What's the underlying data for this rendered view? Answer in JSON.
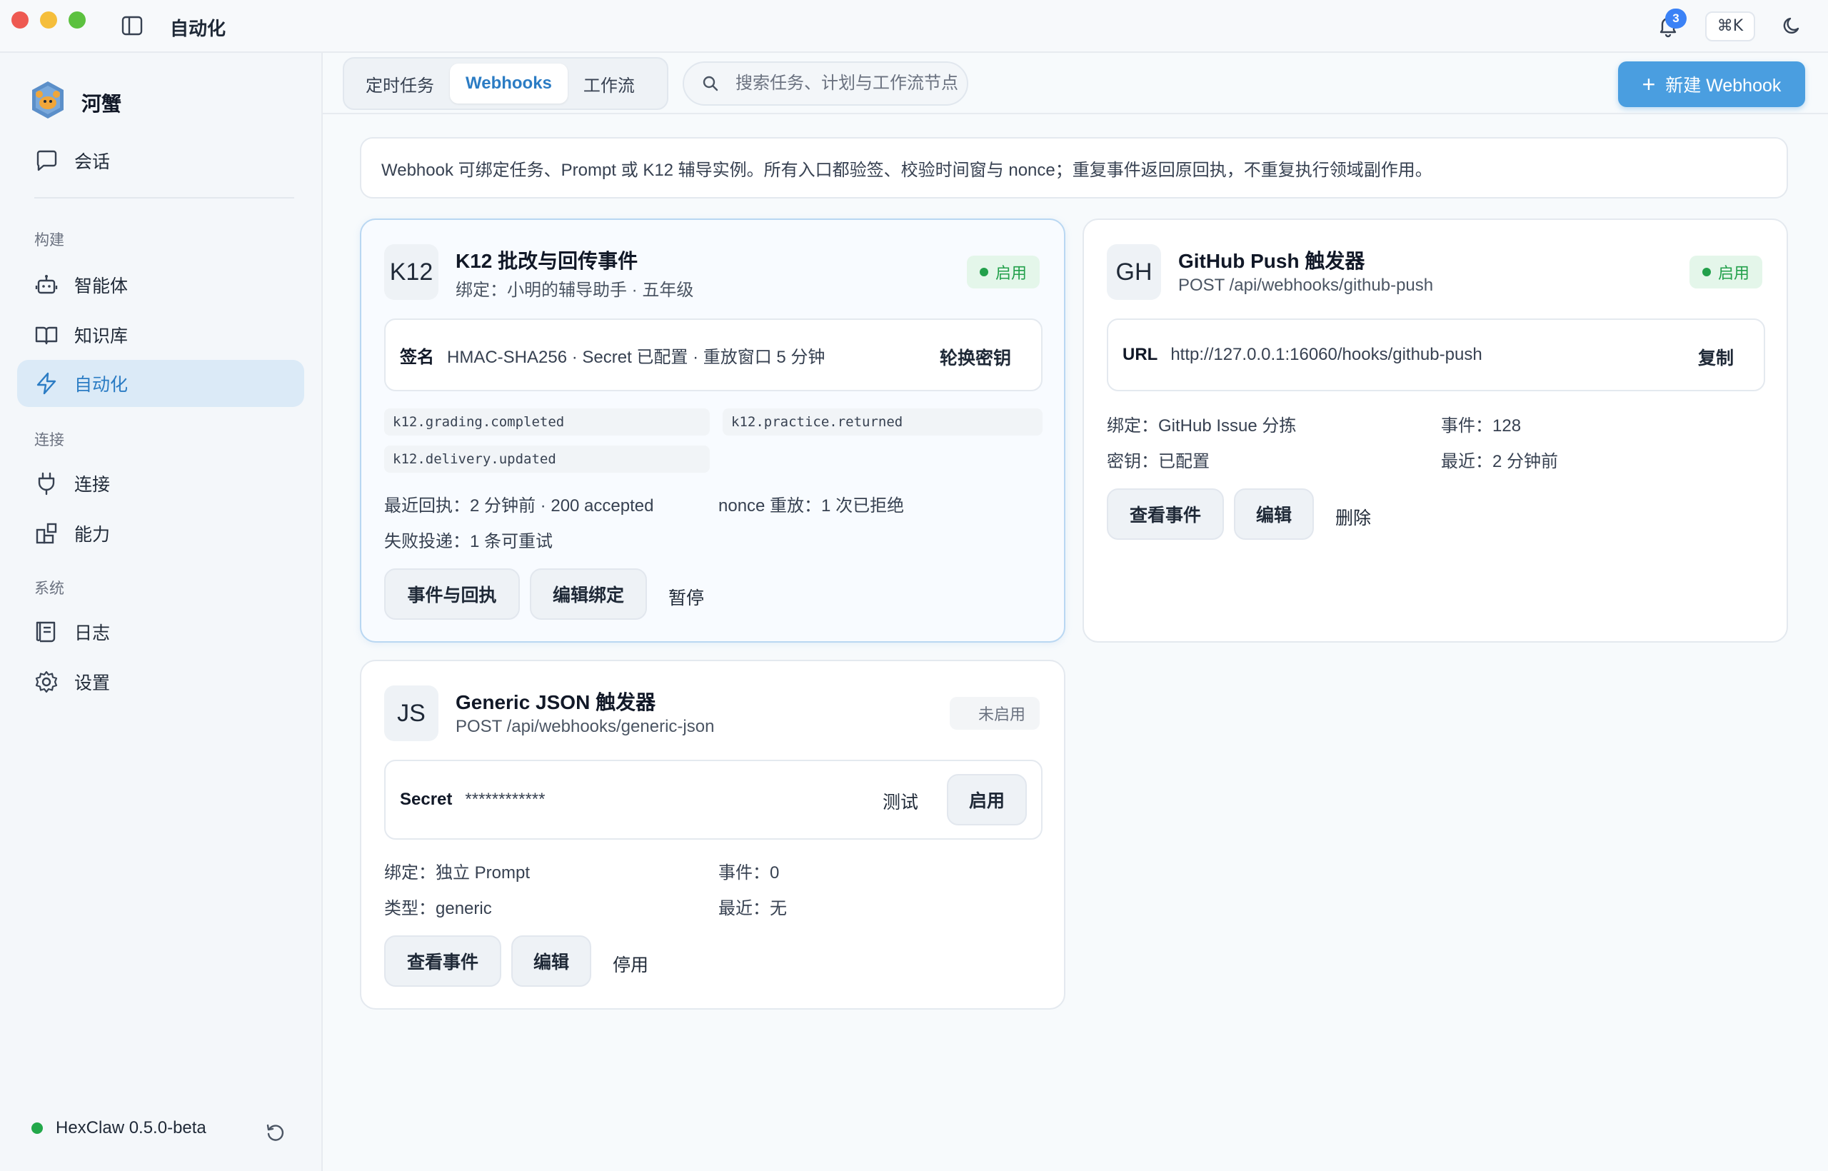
{
  "window": {
    "title": "自动化",
    "notifications": "3",
    "shortcut": "⌘K"
  },
  "sidebar": {
    "brand": "河蟹",
    "top_item": "会话",
    "sections": {
      "build": "构建",
      "connect": "连接",
      "system": "系统"
    },
    "items": {
      "agents": "智能体",
      "knowledge": "知识库",
      "automation": "自动化",
      "connections": "连接",
      "capabilities": "能力",
      "logs": "日志",
      "settings": "设置"
    },
    "version": "HexClaw 0.5.0-beta"
  },
  "toolbar": {
    "tabs": [
      "定时任务",
      "Webhooks",
      "工作流"
    ],
    "active_tab": "Webhooks",
    "search_placeholder": "搜索任务、计划与工作流节点",
    "new_button": "新建 Webhook"
  },
  "info_text": "Webhook 可绑定任务、Prompt 或 K12 辅导实例。所有入口都验签、校验时间窗与 nonce；重复事件返回原回执，不重复执行领域副作用。",
  "cards": {
    "k12": {
      "avatar": "K12",
      "title": "K12 批改与回传事件",
      "subtitle": "绑定：小明的辅导助手 · 五年级",
      "status": "启用",
      "inner_key": "签名",
      "inner_value": "HMAC-SHA256 · Secret 已配置 · 重放窗口 5 分钟",
      "inner_action": "轮换密钥",
      "tags": [
        "k12.grading.completed",
        "k12.practice.returned",
        "k12.delivery.updated"
      ],
      "meta_receipt": "最近回执：2 分钟前 · 200 accepted",
      "meta_nonce": "nonce 重放：1 次已拒绝",
      "meta_failed": "失败投递：1 条可重试",
      "btn_events": "事件与回执",
      "btn_edit": "编辑绑定",
      "btn_pause": "暂停"
    },
    "github": {
      "avatar": "GH",
      "title": "GitHub Push 触发器",
      "subtitle": "POST /api/webhooks/github-push",
      "status": "启用",
      "inner_key": "URL",
      "inner_value": "http://127.0.0.1:16060/hooks/github-push",
      "inner_action": "复制",
      "meta_binding": "绑定：GitHub Issue 分拣",
      "meta_events": "事件：128",
      "meta_secret": "密钥：已配置",
      "meta_recent": "最近：2 分钟前",
      "btn_events": "查看事件",
      "btn_edit": "编辑",
      "btn_delete": "删除"
    },
    "generic": {
      "avatar": "JS",
      "title": "Generic JSON 触发器",
      "subtitle": "POST /api/webhooks/generic-json",
      "status": "未启用",
      "inner_key": "Secret",
      "inner_value": "************",
      "inner_test": "测试",
      "inner_enable": "启用",
      "meta_binding": "绑定：独立 Prompt",
      "meta_events": "事件：0",
      "meta_type": "类型：generic",
      "meta_recent": "最近：无",
      "btn_events": "查看事件",
      "btn_edit": "编辑",
      "btn_disable": "停用"
    }
  },
  "colors": {
    "accent": "#4a9ee0",
    "active_nav": "#dbeaf7",
    "status_green": "#22a04b"
  }
}
